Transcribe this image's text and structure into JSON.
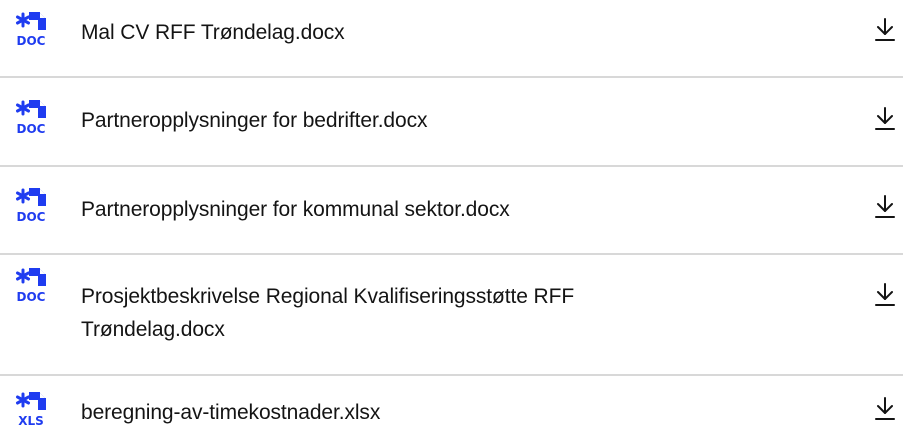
{
  "files": [
    {
      "name": "Mal CV RFF Trøndelag.docx",
      "type_badge": "DOC",
      "icon": "doc-file-icon",
      "action_icon": "download-icon"
    },
    {
      "name": "Partneropplysninger for bedrifter.docx",
      "type_badge": "DOC",
      "icon": "doc-file-icon",
      "action_icon": "download-icon"
    },
    {
      "name": "Partneropplysninger for kommunal sektor.docx",
      "type_badge": "DOC",
      "icon": "doc-file-icon",
      "action_icon": "download-icon"
    },
    {
      "name": "Prosjektbeskrivelse Regional Kvalifiseringsstøtte RFF Trøndelag.docx",
      "type_badge": "DOC",
      "icon": "doc-file-icon",
      "action_icon": "download-icon"
    },
    {
      "name": "beregning-av-timekostnader.xlsx",
      "type_badge": "XLS",
      "icon": "xls-file-icon",
      "action_icon": "download-icon"
    }
  ],
  "colors": {
    "icon_blue": "#1f3cf0",
    "text": "#141414",
    "divider": "#d8d8d8"
  }
}
